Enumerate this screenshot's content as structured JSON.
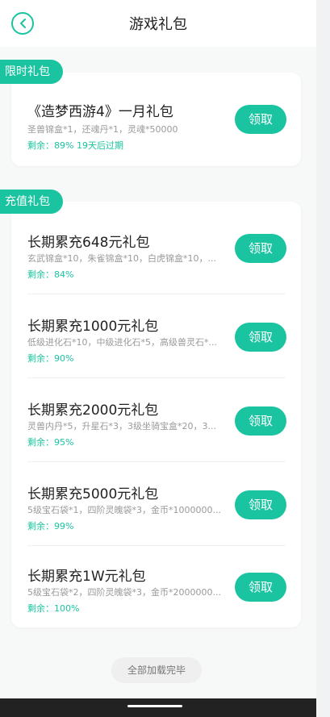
{
  "header": {
    "title": "游戏礼包",
    "back_icon": "chevron-left-circle-icon"
  },
  "colors": {
    "accent": "#1bc4a0",
    "background": "#f7f8f8",
    "card": "#ffffff"
  },
  "sections": [
    {
      "tag": "限时礼包",
      "items": [
        {
          "title": "《造梦西游4》一月礼包",
          "desc": "圣兽锦盒*1，还魂丹*1，灵魂*50000",
          "remain": "剩余：89%  19天后过期",
          "button": "领取"
        }
      ]
    },
    {
      "tag": "充值礼包",
      "items": [
        {
          "title": "长期累充648元礼包",
          "desc": "玄武锦盒*10，朱雀锦盒*10，白虎锦盒*10，...",
          "remain": "剩余：84%",
          "button": "领取"
        },
        {
          "title": "长期累充1000元礼包",
          "desc": "低级进化石*10，中级进化石*5，高级兽灵石*...",
          "remain": "剩余：90%",
          "button": "领取"
        },
        {
          "title": "长期累充2000元礼包",
          "desc": "灵兽内丹*5，升星石*3，3级坐骑宝盒*20，3...",
          "remain": "剩余：95%",
          "button": "领取"
        },
        {
          "title": "长期累充5000元礼包",
          "desc": "5级宝石袋*1，四阶灵魄袋*3，金币*1000000...",
          "remain": "剩余：99%",
          "button": "领取"
        },
        {
          "title": "长期累充1W元礼包",
          "desc": "5级宝石袋*2，四阶灵魄袋*3，金币*2000000...",
          "remain": "剩余：100%",
          "button": "领取"
        }
      ]
    }
  ],
  "footer": {
    "status": "全部加载完毕"
  }
}
